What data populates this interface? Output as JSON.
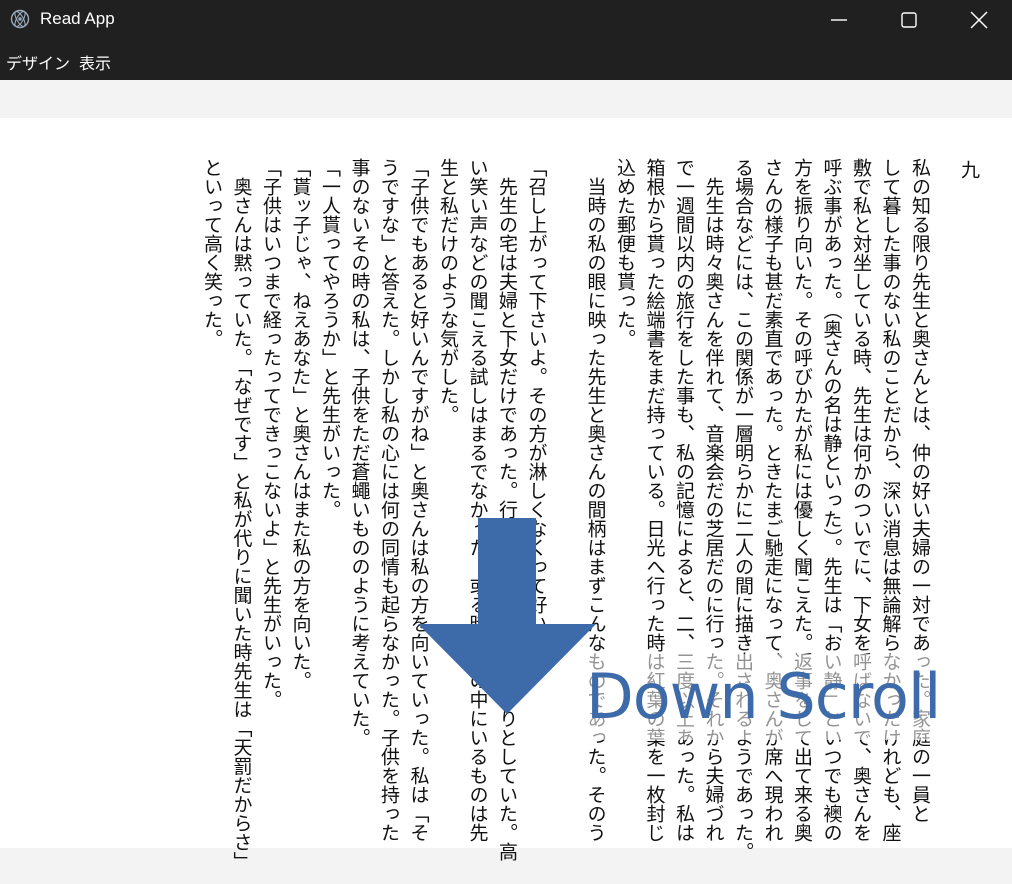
{
  "window": {
    "title": "Read App",
    "icons": {
      "app": "app-logo-icon",
      "minimize": "minimize-icon",
      "maximize": "maximize-icon",
      "close": "close-icon"
    }
  },
  "menu": {
    "items": [
      "デザイン",
      "表示"
    ]
  },
  "page": {
    "number": "九",
    "columns": [
      "私の知る限り先生と奥さんとは、仲の好い夫婦の一対であった。家庭の一員と",
      "して暮した事のない私のことだから、深い消息は無論解らなかったけれども、座",
      "敷で私と対坐している時、先生は何かのついでに、下女を呼ばないで、奥さんを",
      "呼ぶ事があった。（奥さんの名は静といった）。先生は「おい静」といつでも襖の",
      "方を振り向いた。その呼びかたが私には優しく聞こえた。返事をして出て来る奥",
      "さんの様子も甚だ素直であった。ときたまご馳走になって、奥さんが席へ現われ",
      "る場合などには、この関係が一層明らかに二人の間に描き出されるようであった。",
      "　先生は時々奥さんを伴れて、音楽会だの芝居だのに行った。それから夫婦づれ",
      "で一週間以内の旅行をした事も、私の記憶によると、二、三度以上あった。私は",
      "箱根から貰った絵端書をまだ持っている。日光へ行った時は紅葉の葉を一枚封じ",
      "込めた郵便も貰った。",
      "　当時の私の眼に映った先生と奥さんの間柄はまずこんなものであった。そのう",
      "",
      "「召し上がって下さいよ。その方が淋しくなくって好いから」",
      "　先生の宅は夫婦と下女だけであった。行くたびに大抵はひっそりとしていた。高",
      "い笑い声などの聞こえる試しはまるでなかった。或る時は宅の中にいるものは先",
      "生と私だけのような気がした。",
      "「子供でもあると好いんですがね」と奥さんは私の方を向いていった。私は「そ",
      "うですな」と答えた。しかし私の心には何の同情も起らなかった。子供を持った",
      "事のないその時の私は、子供をただ蒼蠅いもののように考えていた。",
      "「一人貰ってやろうか」と先生がいった。",
      "「貰ッ子じゃ、ねえあなた」と奥さんはまた私の方を向いた。",
      "「子供はいつまで経ったってできっこないよ」と先生がいった。",
      "　奥さんは黙っていた。「なぜです」と私が代りに聞いた時先生は「天罰だからさ」",
      "といって高く笑った。"
    ]
  },
  "overlay": {
    "label": "Down Scroll",
    "arrow_icon": "down-arrow-icon",
    "color": "#3d6aa8"
  }
}
